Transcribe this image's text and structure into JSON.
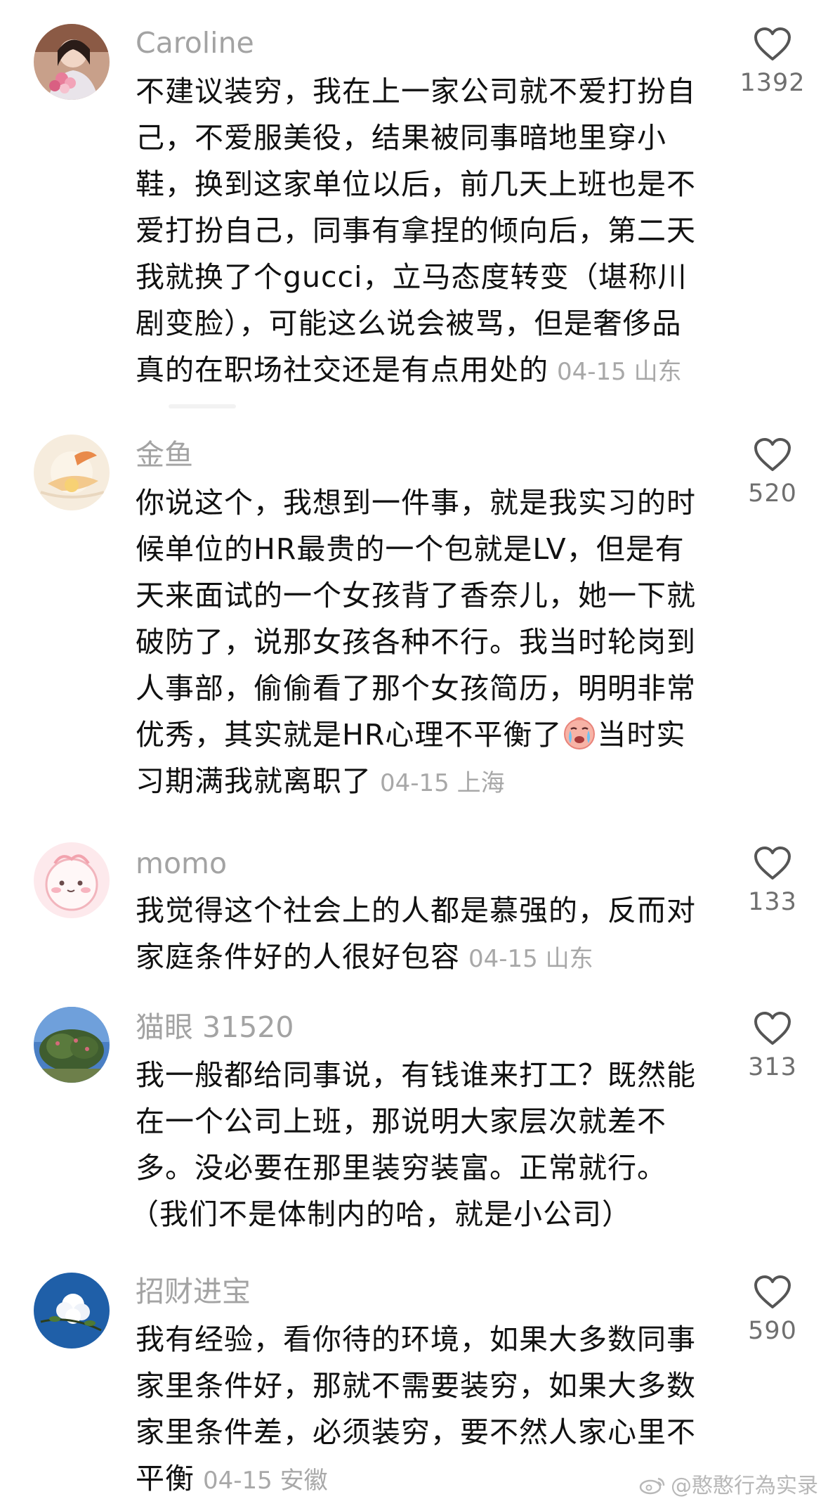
{
  "comments": [
    {
      "username": "Caroline",
      "lines": [
        "不建议装穷，我在上一家公司就不爱打扮自",
        "己，不爱服美役，结果被同事暗地里穿小",
        "鞋，换到这家单位以后，前几天上班也是不",
        "爱打扮自己，同事有拿捏的倾向后，第二天",
        "我就换了个gucci，立马态度转变（堪称川",
        "剧变脸），可能这么说会被骂，但是奢侈品",
        "真的在职场社交还是有点用处的"
      ],
      "meta": "04-15 山东",
      "likes": "1392"
    },
    {
      "username": "金鱼",
      "lines": [
        "你说这个，我想到一件事，就是我实习的时",
        "候单位的HR最贵的一个包就是LV，但是有",
        "天来面试的一个女孩背了香奈儿，她一下就",
        "破防了，说那女孩各种不行。我当时轮岗到",
        "人事部，偷偷看了那个女孩简历，明明非常",
        "优秀，其实就是HR心理不平衡了",
        "当时实",
        "习期满我就离职了"
      ],
      "meta": "04-15 上海",
      "likes": "520"
    },
    {
      "username": "momo",
      "lines": [
        "我觉得这个社会上的人都是慕强的，反而对",
        "家庭条件好的人很好包容"
      ],
      "meta": "04-15 山东",
      "likes": "133"
    },
    {
      "username": "猫眼 31520",
      "lines": [
        "我一般都给同事说，有钱谁来打工？既然能",
        "在一个公司上班，那说明大家层次就差不",
        "多。没必要在那里装穷装富。正常就行。",
        "（我们不是体制内的哈，就是小公司）"
      ],
      "meta": "",
      "likes": "313"
    },
    {
      "username": "招财进宝",
      "lines": [
        "我有经验，看你待的环境，如果大多数同事",
        "家里条件好，那就不需要装穷，如果大多数",
        "家里条件差，必须装穷，要不然人家心里不",
        "平衡"
      ],
      "meta": "04-15 安徽",
      "likes": "590"
    }
  ],
  "watermark": "@憨憨行為实录",
  "icons": {
    "like": "heart-outline-icon",
    "emoji": "crying-face-emoji",
    "watermark_logo": "weibo-logo-icon"
  },
  "colors": {
    "text": "#111111",
    "username": "#a3a3a3",
    "meta": "#a8a8a8",
    "like_count": "#6f6f6f",
    "heart": "#555555"
  }
}
